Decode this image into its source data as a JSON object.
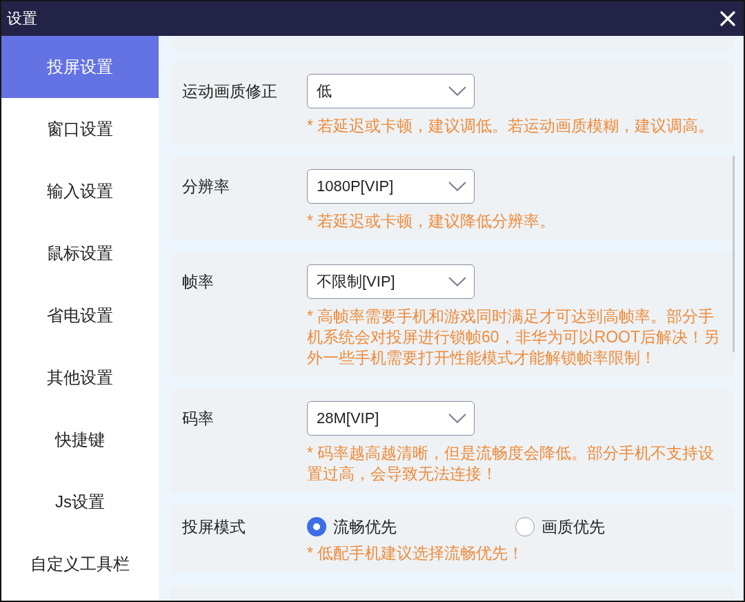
{
  "window": {
    "title": "设置"
  },
  "sidebar": {
    "items": [
      {
        "label": "投屏设置",
        "selected": true
      },
      {
        "label": "窗口设置",
        "selected": false
      },
      {
        "label": "输入设置",
        "selected": false
      },
      {
        "label": "鼠标设置",
        "selected": false
      },
      {
        "label": "省电设置",
        "selected": false
      },
      {
        "label": "其他设置",
        "selected": false
      },
      {
        "label": "快捷键",
        "selected": false
      },
      {
        "label": "Js设置",
        "selected": false
      },
      {
        "label": "自定义工具栏",
        "selected": false
      }
    ]
  },
  "settings": [
    {
      "kind": "select",
      "label": "运动画质修正",
      "value": "低",
      "hint": "* 若延迟或卡顿，建议调低。若运动画质模糊，建议调高。"
    },
    {
      "kind": "select",
      "label": "分辨率",
      "value": "1080P[VIP]",
      "hint": "* 若延迟或卡顿，建议降低分辨率。"
    },
    {
      "kind": "select",
      "label": "帧率",
      "value": "不限制[VIP]",
      "hint": "* 高帧率需要手机和游戏同时满足才可达到高帧率。部分手机系统会对投屏进行锁帧60，非华为可以ROOT后解决！另外一些手机需要打开性能模式才能解锁帧率限制！"
    },
    {
      "kind": "select",
      "label": "码率",
      "value": "28M[VIP]",
      "hint": "* 码率越高越清晰，但是流畅度会降低。部分手机不支持设置过高，会导致无法连接！"
    },
    {
      "kind": "radio",
      "label": "投屏模式",
      "options": [
        {
          "label": "流畅优先",
          "selected": true
        },
        {
          "label": "画质优先",
          "selected": false
        }
      ],
      "hint": "* 低配手机建议选择流畅优先！"
    }
  ]
}
